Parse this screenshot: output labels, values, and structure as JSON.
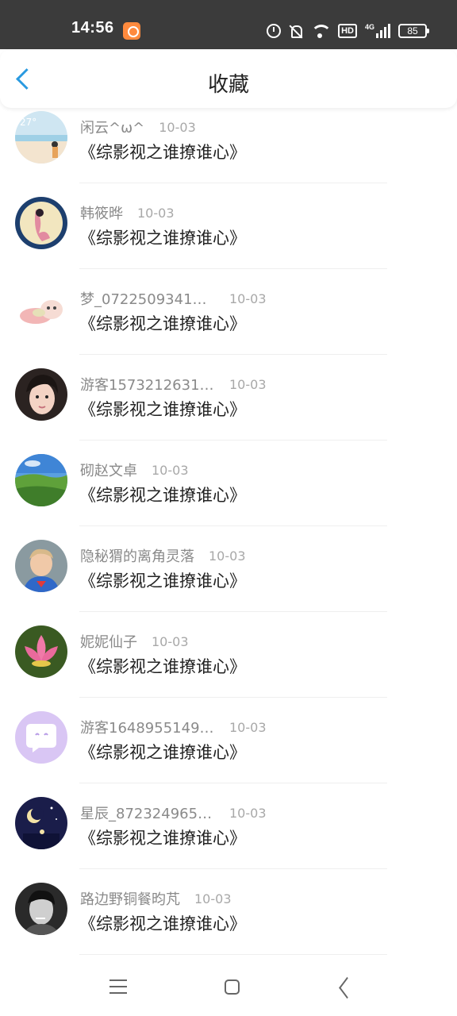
{
  "status_bar": {
    "time": "14:56",
    "icons": [
      "app-notification-icon",
      "alarm-icon",
      "mute-icon",
      "wifi-icon",
      "hd-icon",
      "signal-icon",
      "battery-icon"
    ],
    "hd_label": "HD",
    "network_label": "4G",
    "battery": "85"
  },
  "header": {
    "back_icon": "chevron-left-icon",
    "title": "收藏",
    "accent_color": "#2a9ae0"
  },
  "items": [
    {
      "name": "闲云^ω^",
      "date": "10-03",
      "book": "《综影视之谁撩谁心》",
      "avatar": "sky-girl-avatar"
    },
    {
      "name": "韩筱晔",
      "date": "10-03",
      "book": "《综影视之谁撩谁心》",
      "avatar": "moon-fairy-avatar"
    },
    {
      "name": "梦_072250934158...",
      "date": "10-03",
      "book": "《综影视之谁撩谁心》",
      "avatar": "cute-pig-avatar"
    },
    {
      "name": "游客15732126317...",
      "date": "10-03",
      "book": "《综影视之谁撩谁心》",
      "avatar": "girl-portrait-avatar"
    },
    {
      "name": "砌赵文卓",
      "date": "10-03",
      "book": "《综影视之谁撩谁心》",
      "avatar": "landscape-avatar"
    },
    {
      "name": "隐秘猬的离角灵落",
      "date": "10-03",
      "book": "《综影视之谁撩谁心》",
      "avatar": "superman-kid-avatar"
    },
    {
      "name": "妮妮仙子",
      "date": "10-03",
      "book": "《综影视之谁撩谁心》",
      "avatar": "lotus-avatar"
    },
    {
      "name": "游客16489551493...",
      "date": "10-03",
      "book": "《综影视之谁撩谁心》",
      "avatar": "chat-bubble-avatar"
    },
    {
      "name": "星辰_8723249654...",
      "date": "10-03",
      "book": "《综影视之谁撩谁心》",
      "avatar": "night-moon-avatar"
    },
    {
      "name": "路边野铜餐昀芃",
      "date": "10-03",
      "book": "《综影视之谁撩谁心》",
      "avatar": "man-portrait-avatar"
    }
  ],
  "nav_bar": {
    "icons": [
      "menu-icon",
      "home-icon",
      "back-icon"
    ]
  }
}
